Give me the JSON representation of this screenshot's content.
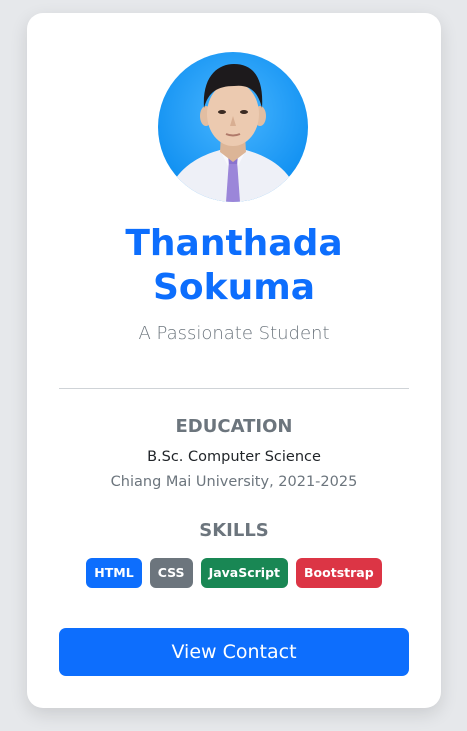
{
  "profile": {
    "name_line1": "Thanthada",
    "name_line2": "Sokuma",
    "tagline": "A Passionate Student",
    "photo": "portrait-photo"
  },
  "education": {
    "title": "EDUCATION",
    "degree": "B.Sc. Computer Science",
    "school": "Chiang Mai University, 2021-2025"
  },
  "skills": {
    "title": "SKILLS",
    "items": [
      {
        "label": "HTML",
        "color": "#0d6efd"
      },
      {
        "label": "CSS",
        "color": "#6c757d"
      },
      {
        "label": "JavaScript",
        "color": "#198754"
      },
      {
        "label": "Bootstrap",
        "color": "#dc3545"
      }
    ]
  },
  "actions": {
    "contact_label": "View Contact"
  },
  "colors": {
    "accent": "#0d6efd",
    "muted": "#6c757d",
    "page_bg": "#e6e8eb",
    "card_bg": "#ffffff"
  }
}
